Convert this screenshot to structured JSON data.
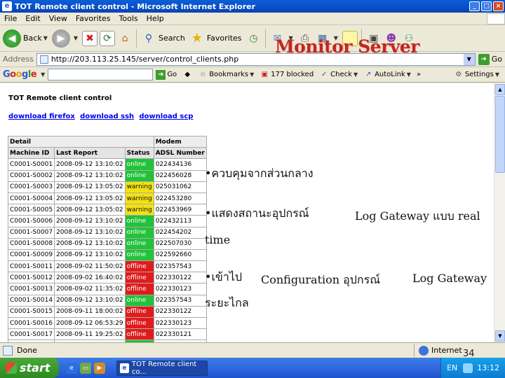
{
  "window": {
    "title": "TOT Remote client control - Microsoft Internet Explorer"
  },
  "menu": [
    "File",
    "Edit",
    "View",
    "Favorites",
    "Tools",
    "Help"
  ],
  "toolbar": {
    "back_label": "Back",
    "search_label": "Search",
    "favorites_label": "Favorites"
  },
  "address": {
    "label": "Address",
    "url": "http://203.113.25.145/server/control_clients.php",
    "go_label": "Go"
  },
  "googlebar": {
    "go_label": "Go",
    "bookmarks_label": "Bookmarks",
    "blocked_label": "177 blocked",
    "check_label": "Check",
    "autolink_label": "AutoLink",
    "more_label": "»",
    "settings_label": "Settings"
  },
  "page": {
    "title": "TOT Remote client control",
    "links": [
      "download firefox",
      "download ssh",
      "download scp"
    ],
    "table": {
      "group_headers": [
        "Detail",
        "Modem"
      ],
      "headers": [
        "Machine ID",
        "Last Report",
        "Status",
        "ADSL Number"
      ],
      "rows": [
        [
          "C0001-S0001",
          "2008-09-12 13:10:02",
          "online",
          "022434136"
        ],
        [
          "C0001-S0002",
          "2008-09-12 13:10:02",
          "online",
          "022456028"
        ],
        [
          "C0001-S0003",
          "2008-09-12 13:05:02",
          "warning",
          "025031062"
        ],
        [
          "C0001-S0004",
          "2008-09-12 13:05:02",
          "warning",
          "022453280"
        ],
        [
          "C0001-S0005",
          "2008-09-12 13:05:02",
          "warning",
          "022453969"
        ],
        [
          "C0001-S0006",
          "2008-09-12 13:10:02",
          "online",
          "022432113"
        ],
        [
          "C0001-S0007",
          "2008-09-12 13:10:02",
          "online",
          "022454202"
        ],
        [
          "C0001-S0008",
          "2008-09-12 13:10:02",
          "online",
          "022507030"
        ],
        [
          "C0001-S0009",
          "2008-09-12 13:10:02",
          "online",
          "022592660"
        ],
        [
          "C0001-S0011",
          "2008-09-02 11:50:02",
          "offline",
          "022357543"
        ],
        [
          "C0001-S0012",
          "2008-09-02 16:40:02",
          "offline",
          "022330122"
        ],
        [
          "C0001-S0013",
          "2008-09-02 11:35:02",
          "offline",
          "022330123"
        ],
        [
          "C0001-S0014",
          "2008-09-12 13:10:02",
          "online",
          "022357543"
        ],
        [
          "C0001-S0015",
          "2008-09-11 18:00:02",
          "offline",
          "022330122"
        ],
        [
          "C0001-S0016",
          "2008-09-12 06:53:29",
          "offline",
          "022330123"
        ],
        [
          "C0001-S0017",
          "2008-09-11 19:25:02",
          "offline",
          "022330121"
        ],
        [
          "",
          "",
          "online",
          ""
        ]
      ]
    }
  },
  "slide": {
    "title": "Monitor Server",
    "bullet1": "•ควบคุมจากส่วนกลาง",
    "bullet2_a": "•แสดงสถานะอุปกรณ์",
    "bullet2_b": "Log Gateway แบบ real",
    "bullet2_c": "time",
    "bullet3_a": "•เข้าไป",
    "bullet3_b": "Configuration อุปกรณ์",
    "bullet3_c": "Log Gateway",
    "bullet3_d": "ระยะไกล",
    "page_number": "34"
  },
  "status": {
    "text": "Done",
    "zone": "Internet"
  },
  "taskbar": {
    "start": "start",
    "task": "TOT Remote client co...",
    "lang": "EN",
    "time": "13:12"
  },
  "colors": {
    "online": "#22c23a",
    "warning": "#f2e214",
    "offline": "#e01b1b",
    "slide_title": "#c0281e"
  }
}
